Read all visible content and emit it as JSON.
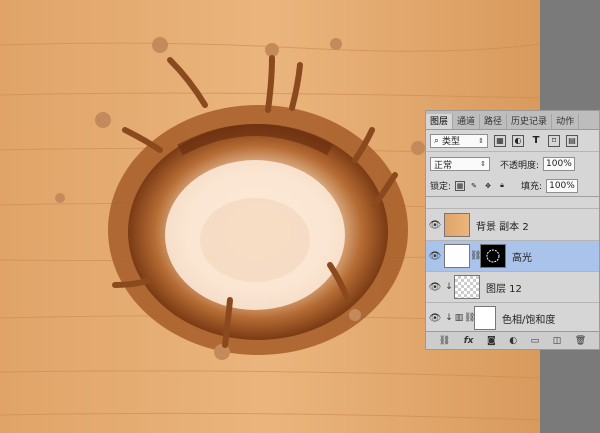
{
  "panel": {
    "tabs": [
      "图层",
      "通道",
      "路径",
      "历史记录",
      "动作"
    ],
    "filter": {
      "label": "类型",
      "icon": "search-icon"
    },
    "blend_mode": "正常",
    "opacity_label": "不透明度:",
    "opacity_value": "100%",
    "lock_label": "锁定:",
    "fill_label": "填充:",
    "fill_value": "100%"
  },
  "layers": [
    {
      "name": "背景 副本 2"
    },
    {
      "name": "高光"
    },
    {
      "name": "图层 12"
    },
    {
      "name": "色相/饱和度"
    }
  ],
  "bottom_icons": [
    "link-icon",
    "fx-icon",
    "mask-icon",
    "adjustment-icon",
    "group-folder-icon",
    "new-layer-icon",
    "delete-icon"
  ],
  "colors": {
    "wood_light": "#e8b27a",
    "wood_dark": "#cf8e52",
    "panel_bg": "#d6d6d6",
    "selected_row": "#a9c3ea",
    "outside_gray": "#7a7a7a"
  }
}
